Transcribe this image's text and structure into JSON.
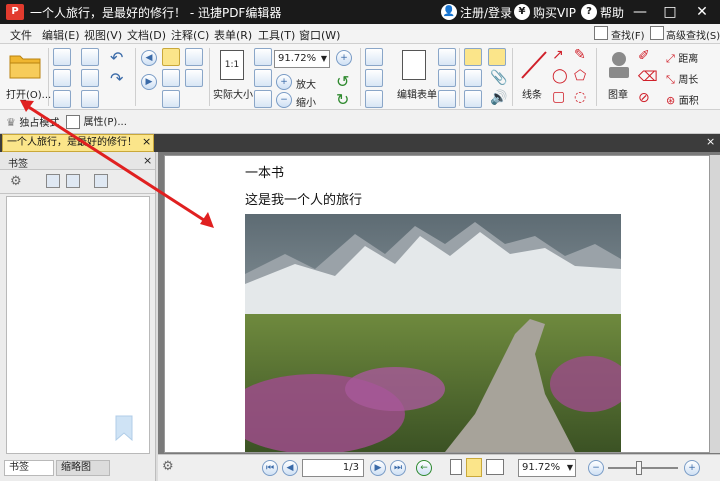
{
  "titlebar": {
    "logo_text": "P",
    "title": "一个人旅行，是最好的修行！ - 迅捷PDF编辑器",
    "login": "注册/登录",
    "buy_vip": "购买VIP",
    "help": "帮助",
    "minimize": "—",
    "maximize": "□",
    "close": "✕"
  },
  "menu": [
    "文件",
    "编辑(E)",
    "视图(V)",
    "文档(D)",
    "注释(C)",
    "表单(R)",
    "工具(T)",
    "窗口(W)"
  ],
  "toolbar": {
    "open_label": "打开(O)...",
    "zoom_value": "91.72%",
    "zoom_in": "放大",
    "zoom_out": "缩小",
    "actual_size": "实际大小",
    "actual_size_icon_text": "1:1",
    "edit_form": "编辑表单",
    "line_label": "线条",
    "stamp_label": "图章",
    "find": "查找(F)",
    "advanced_find": "高级查找(S)",
    "distance": "距离",
    "perimeter": "周长",
    "area": "面积"
  },
  "subbar": {
    "exclusive_mode": "独占模式",
    "properties": "属性(P)..."
  },
  "tab": {
    "doc_title": "一个人旅行，是最好的修行！",
    "close": "×"
  },
  "sidebar": {
    "title": "书签",
    "close": "×",
    "tab_bookmarks": "书签",
    "tab_thumbnails": "缩略图"
  },
  "document": {
    "line1": "一本书",
    "line2": "这是我一个人的旅行"
  },
  "statusbar": {
    "page_indicator": "1/3",
    "zoom_value": "91.72%"
  },
  "colors": {
    "title_bg": "#1a1a1a",
    "tab_active": "#fbe58a",
    "annotation_arrow": "#e02020"
  }
}
